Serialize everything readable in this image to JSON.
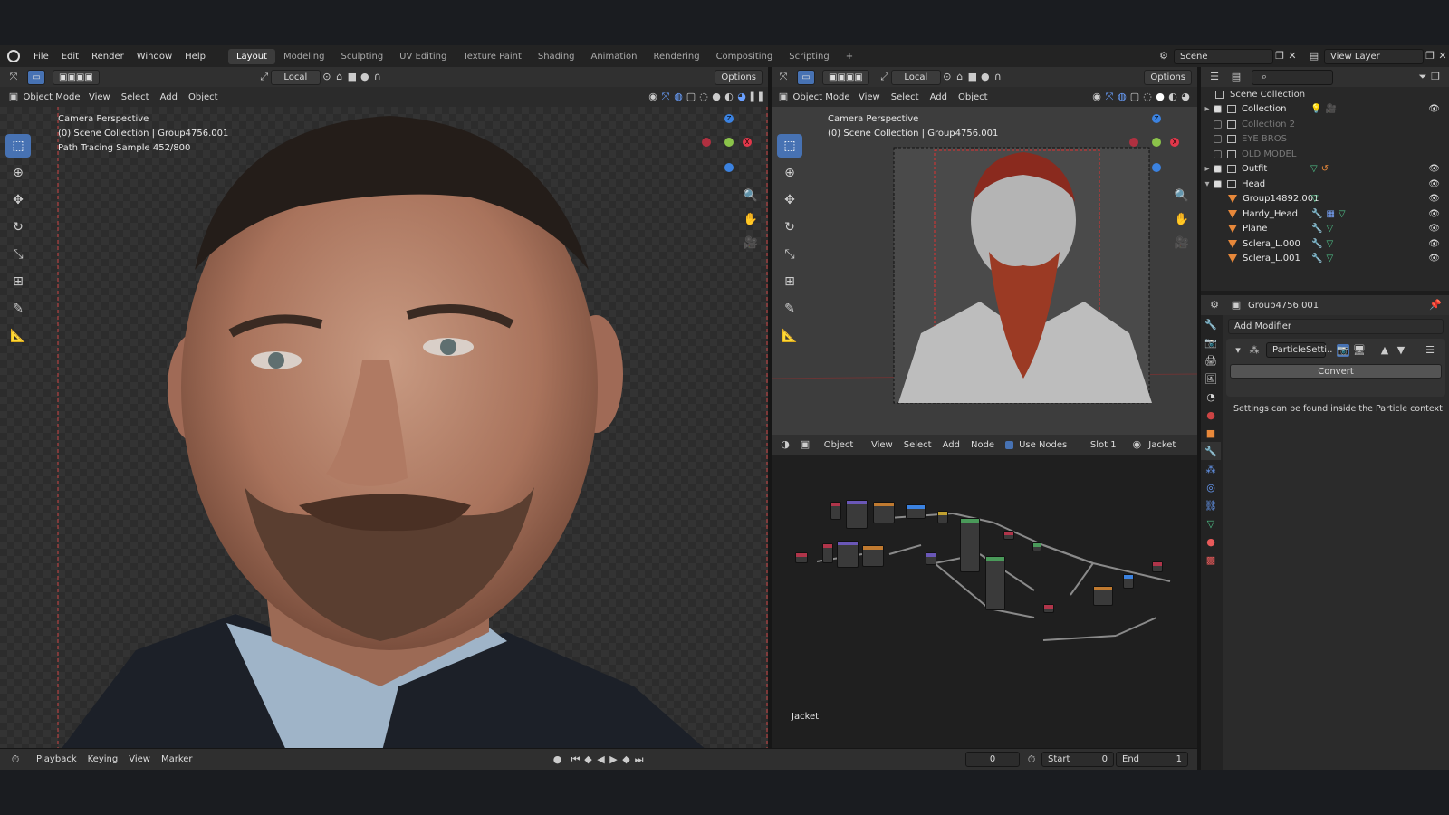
{
  "menu": [
    "File",
    "Edit",
    "Render",
    "Window",
    "Help"
  ],
  "workspaces": [
    "Layout",
    "Modeling",
    "Sculpting",
    "UV Editing",
    "Texture Paint",
    "Shading",
    "Animation",
    "Rendering",
    "Compositing",
    "Scripting",
    "+"
  ],
  "active_workspace": "Layout",
  "scene": {
    "label": "Scene"
  },
  "view_layer": {
    "label": "View Layer"
  },
  "viewport_left": {
    "transform_orientation": "Local",
    "options_label": "Options",
    "mode": "Object Mode",
    "menus": [
      "View",
      "Select",
      "Add",
      "Object"
    ],
    "overlay_lines": [
      "Camera Perspective",
      "(0) Scene Collection | Group4756.001",
      "Path Tracing Sample 452/800"
    ]
  },
  "viewport_right": {
    "transform_orientation": "Local",
    "options_label": "Options",
    "mode": "Object Mode",
    "menus": [
      "View",
      "Select",
      "Add",
      "Object"
    ],
    "overlay_lines": [
      "Camera Perspective",
      "(0) Scene Collection | Group4756.001"
    ]
  },
  "gizmo_axes": {
    "z": "Z",
    "x": "X",
    "y": "Y"
  },
  "node_editor": {
    "object_type": "Object",
    "menus": [
      "View",
      "Select",
      "Add",
      "Node"
    ],
    "use_nodes_label": "Use Nodes",
    "use_nodes_checked": true,
    "slot": "Slot 1",
    "material": "Jacket",
    "material_label": "Jacket"
  },
  "outliner": {
    "root": "Scene Collection",
    "rows": [
      {
        "label": "Collection",
        "type": "collection",
        "checked": true,
        "expanded": false,
        "depth": 0,
        "visible": true
      },
      {
        "label": "Collection 2",
        "type": "collection",
        "checked": false,
        "depth": 0,
        "visible": false
      },
      {
        "label": "EYE BROS",
        "type": "collection",
        "checked": false,
        "depth": 0,
        "visible": false
      },
      {
        "label": "OLD MODEL",
        "type": "collection",
        "checked": false,
        "depth": 0,
        "visible": false
      },
      {
        "label": "Outfit",
        "type": "collection",
        "checked": true,
        "expanded": false,
        "depth": 0,
        "visible": true
      },
      {
        "label": "Head",
        "type": "collection",
        "checked": true,
        "expanded": true,
        "depth": 0,
        "visible": true
      },
      {
        "label": "Group14892.001",
        "type": "object",
        "depth": 1,
        "visible": true
      },
      {
        "label": "Hardy_Head",
        "type": "object",
        "depth": 1,
        "visible": true
      },
      {
        "label": "Plane",
        "type": "object",
        "depth": 1,
        "visible": true
      },
      {
        "label": "Sclera_L.000",
        "type": "object",
        "depth": 1,
        "visible": true
      },
      {
        "label": "Sclera_L.001",
        "type": "object",
        "depth": 1,
        "visible": true
      }
    ]
  },
  "properties": {
    "object_name": "Group4756.001",
    "add_modifier": "Add Modifier",
    "modifier_name": "ParticleSetti..",
    "convert_label": "Convert",
    "info_text": "Settings can be found inside the Particle context"
  },
  "timeline": {
    "menus": [
      "Playback",
      "Keying",
      "View",
      "Marker"
    ],
    "current_frame": "0",
    "start_label": "Start",
    "start_value": "0",
    "end_label": "End",
    "end_value": "1"
  },
  "colors": {
    "accent": "#4772b3",
    "x_axis": "#e2374a",
    "y_axis": "#8bc34a",
    "z_axis": "#3b82e0",
    "object_orange": "#e8883a"
  }
}
